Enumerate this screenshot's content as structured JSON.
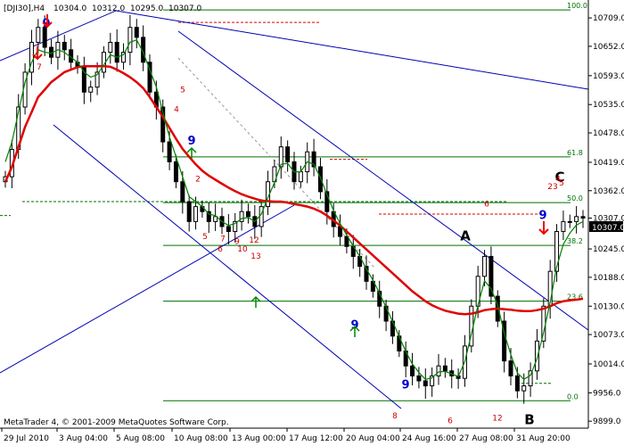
{
  "chart_data": {
    "type": "line",
    "title": "[DJI30],H4",
    "ohlc_header": {
      "open": "10304.0",
      "high": "10312.0",
      "low": "10295.0",
      "close": "10307.0"
    },
    "x_ticks": [
      "29 Jul 2010",
      "3 Aug 04:00",
      "5 Aug 08:00",
      "10 Aug 08:00",
      "13 Aug 00:00",
      "17 Aug 12:00",
      "20 Aug 04:00",
      "24 Aug 16:00",
      "27 Aug 08:00",
      "31 Aug 20:00"
    ],
    "y_ticks": [
      10709.0,
      10652.0,
      10593.0,
      10535.0,
      10478.0,
      10419.0,
      10362.0,
      10307.0,
      10245.0,
      10188.0,
      10130.0,
      10073.0,
      10014.0,
      9956.0,
      9899.0
    ],
    "ylim": [
      9885,
      10745
    ],
    "price_label": "10307.0",
    "fib_levels": [
      {
        "label": "100.0",
        "price": 10725
      },
      {
        "label": "61.8",
        "price": 10430
      },
      {
        "label": "50.0",
        "price": 10338
      },
      {
        "label": "38.2",
        "price": 10252
      },
      {
        "label": "23.6",
        "price": 10140
      },
      {
        "label": "0.0",
        "price": 9940
      }
    ],
    "close_prices": [
      10390,
      10445,
      10530,
      10600,
      10660,
      10690,
      10650,
      10630,
      10660,
      10645,
      10620,
      10610,
      10560,
      10570,
      10600,
      10640,
      10660,
      10620,
      10640,
      10690,
      10670,
      10620,
      10560,
      10530,
      10460,
      10420,
      10380,
      10340,
      10300,
      10330,
      10320,
      10300,
      10310,
      10290,
      10280,
      10300,
      10320,
      10310,
      10290,
      10330,
      10380,
      10410,
      10450,
      10420,
      10380,
      10400,
      10440,
      10410,
      10360,
      10320,
      10290,
      10270,
      10250,
      10230,
      10210,
      10180,
      10160,
      10130,
      10100,
      10070,
      10040,
      10010,
      9990,
      9980,
      9970,
      9990,
      10010,
      10000,
      9990,
      9985,
      10050,
      10130,
      10190,
      10230,
      10150,
      10100,
      10020,
      9990,
      9960,
      9970,
      10000,
      10060,
      10130,
      10200,
      10280,
      10300,
      10300,
      10310,
      10307
    ],
    "ema_fast": [
      10420,
      10460,
      10520,
      10580,
      10620,
      10645,
      10640,
      10638,
      10645,
      10640,
      10630,
      10620,
      10600,
      10590,
      10595,
      10615,
      10635,
      10630,
      10635,
      10660,
      10665,
      10640,
      10605,
      10570,
      10520,
      10470,
      10430,
      10390,
      10350,
      10340,
      10330,
      10315,
      10312,
      10300,
      10292,
      10296,
      10306,
      10308,
      10300,
      10315,
      10348,
      10378,
      10415,
      10417,
      10400,
      10400,
      10420,
      10415,
      10388,
      10354,
      10322,
      10296,
      10273,
      10251,
      10230,
      10205,
      10182,
      10156,
      10128,
      10099,
      10069,
      10039,
      10014,
      9997,
      9983,
      9986,
      9998,
      9999,
      9994,
      9989,
      10019,
      10074,
      10132,
      10181,
      10165,
      10132,
      10076,
      10033,
      9996,
      9983,
      9991,
      10025,
      10077,
      10138,
      10209,
      10254,
      10277,
      10293,
      10300
    ],
    "ema_slow": [
      10380,
      10410,
      10450,
      10490,
      10520,
      10550,
      10565,
      10580,
      10590,
      10600,
      10605,
      10610,
      10612,
      10612,
      10612,
      10612,
      10611,
      10605,
      10598,
      10590,
      10580,
      10568,
      10550,
      10530,
      10510,
      10488,
      10466,
      10446,
      10430,
      10415,
      10402,
      10392,
      10384,
      10376,
      10368,
      10361,
      10355,
      10350,
      10346,
      10342,
      10341,
      10340,
      10340,
      10338,
      10335,
      10333,
      10330,
      10326,
      10320,
      10312,
      10302,
      10292,
      10280,
      10268,
      10256,
      10244,
      10232,
      10220,
      10208,
      10196,
      10184,
      10172,
      10160,
      10150,
      10140,
      10132,
      10126,
      10121,
      10118,
      10115,
      10114,
      10115,
      10118,
      10122,
      10124,
      10125,
      10124,
      10123,
      10121,
      10120,
      10120,
      10122,
      10125,
      10130,
      10136,
      10140,
      10142,
      10143,
      10145
    ],
    "annotations": [
      {
        "text": "A",
        "price": 10262,
        "kind": "letter"
      },
      {
        "text": "B",
        "price": 9893,
        "kind": "letter"
      },
      {
        "text": "C",
        "price": 10380,
        "kind": "letter"
      },
      {
        "text": "9",
        "price": 10690,
        "kind": "setup9"
      },
      {
        "text": "9",
        "price": 10455,
        "kind": "setup9"
      },
      {
        "text": "9",
        "price": 10085,
        "kind": "setup9"
      },
      {
        "text": "9",
        "price": 9965,
        "kind": "setup9"
      },
      {
        "text": "9",
        "price": 10305,
        "kind": "setup9"
      },
      {
        "text": "13",
        "price": 10225,
        "kind": "count"
      },
      {
        "text": "7",
        "price": 10605,
        "kind": "count"
      },
      {
        "text": "5",
        "price": 10560,
        "kind": "count"
      },
      {
        "text": "4",
        "price": 10520,
        "kind": "count"
      },
      {
        "text": "5",
        "price": 10265,
        "kind": "count"
      },
      {
        "text": "7",
        "price": 10260,
        "kind": "count"
      },
      {
        "text": "6",
        "price": 10240,
        "kind": "count"
      },
      {
        "text": "9",
        "price": 10255,
        "kind": "count"
      },
      {
        "text": "10",
        "price": 10240,
        "kind": "count"
      },
      {
        "text": "12",
        "price": 10258,
        "kind": "count"
      },
      {
        "text": "2",
        "price": 10380,
        "kind": "count"
      },
      {
        "text": "6",
        "price": 10330,
        "kind": "count"
      },
      {
        "text": "8",
        "price": 9905,
        "kind": "count"
      },
      {
        "text": "6",
        "price": 9895,
        "kind": "count"
      },
      {
        "text": "12",
        "price": 9900,
        "kind": "count"
      },
      {
        "text": "23",
        "price": 10365,
        "kind": "count"
      },
      {
        "text": "4",
        "price": 10380,
        "kind": "count"
      },
      {
        "text": "5",
        "price": 10372,
        "kind": "count"
      }
    ]
  },
  "footer": "MetaTrader 4, © 2001-2009 MetaQuotes Software Corp.",
  "colors": {
    "fast": "#008000",
    "slow": "#e00000",
    "channel": "#0000b0",
    "fib": "#007000",
    "candle": "#000000"
  }
}
